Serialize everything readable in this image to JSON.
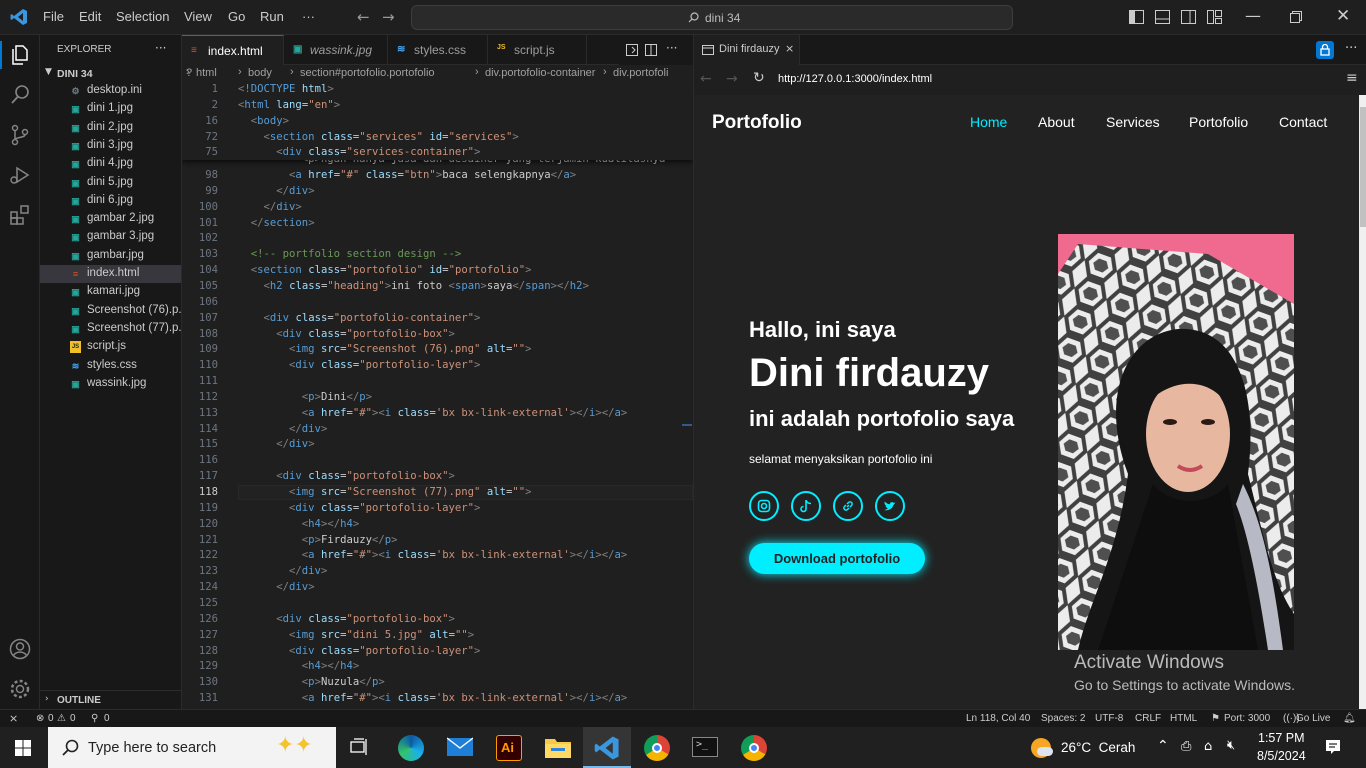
{
  "title_bar": {
    "menus": [
      "File",
      "Edit",
      "Selection",
      "View",
      "Go",
      "Run",
      "···"
    ],
    "command_center": "dini 34"
  },
  "explorer": {
    "title": "EXPLORER",
    "more": "···",
    "folder": "DINI 34",
    "files": [
      {
        "name": "desktop.ini",
        "icon": "gear-icon"
      },
      {
        "name": "dini 1.jpg",
        "icon": "image-icon"
      },
      {
        "name": "dini 2.jpg",
        "icon": "image-icon"
      },
      {
        "name": "dini 3.jpg",
        "icon": "image-icon"
      },
      {
        "name": "dini 4.jpg",
        "icon": "image-icon"
      },
      {
        "name": "dini 5.jpg",
        "icon": "image-icon"
      },
      {
        "name": "dini 6.jpg",
        "icon": "image-icon"
      },
      {
        "name": "gambar 2.jpg",
        "icon": "image-icon"
      },
      {
        "name": "gambar 3.jpg",
        "icon": "image-icon"
      },
      {
        "name": "gambar.jpg",
        "icon": "image-icon"
      },
      {
        "name": "index.html",
        "icon": "html-icon"
      },
      {
        "name": "kamari.jpg",
        "icon": "image-icon"
      },
      {
        "name": "Screenshot (76).p...",
        "icon": "image-icon"
      },
      {
        "name": "Screenshot (77).p...",
        "icon": "image-icon"
      },
      {
        "name": "script.js",
        "icon": "js-icon"
      },
      {
        "name": "styles.css",
        "icon": "css-icon"
      },
      {
        "name": "wassink.jpg",
        "icon": "image-icon"
      }
    ],
    "outline": "OUTLINE"
  },
  "editor": {
    "tabs": [
      {
        "name": "index.html",
        "active": true
      },
      {
        "name": "wassink.jpg",
        "active": false
      },
      {
        "name": "styles.css",
        "active": false
      },
      {
        "name": "script.js",
        "active": false
      }
    ],
    "breadcrumbs": [
      "?",
      "html",
      "body",
      "section#portofolio.portofolio",
      "div.portofolio-container",
      "div.portofoli"
    ],
    "sticky_lines": [
      {
        "n": "1",
        "code": "<!DOCTYPE html>"
      },
      {
        "n": "2",
        "code": "<html lang=\"en\">"
      },
      {
        "n": "16",
        "code": "  <body>"
      },
      {
        "n": "72",
        "code": "    <section class=\"services\" id=\"services\">"
      },
      {
        "n": "75",
        "code": "      <div class=\"services-container\">"
      }
    ],
    "partial_line": "          <p>ngan hanya jasa dan desainer yang terjamin kualitasnya",
    "lines": [
      {
        "n": "98",
        "code": "        <a href=\"#\" class=\"btn\">baca selengkapnya</a>"
      },
      {
        "n": "99",
        "code": "      </div>"
      },
      {
        "n": "100",
        "code": "    </div>"
      },
      {
        "n": "101",
        "code": "  </section>"
      },
      {
        "n": "102",
        "code": ""
      },
      {
        "n": "103",
        "code": "  <!-- portfolio section design -->"
      },
      {
        "n": "104",
        "code": "  <section class=\"portofolio\" id=\"portofolio\">"
      },
      {
        "n": "105",
        "code": "    <h2 class=\"heading\">ini foto <span>saya</span></h2>"
      },
      {
        "n": "106",
        "code": ""
      },
      {
        "n": "107",
        "code": "    <div class=\"portofolio-container\">"
      },
      {
        "n": "108",
        "code": "      <div class=\"portofolio-box\">"
      },
      {
        "n": "109",
        "code": "        <img src=\"Screenshot (76).png\" alt=\"\">"
      },
      {
        "n": "110",
        "code": "        <div class=\"portofolio-layer\">"
      },
      {
        "n": "111",
        "code": ""
      },
      {
        "n": "112",
        "code": "          <p>Dini</p>"
      },
      {
        "n": "113",
        "code": "          <a href=\"#\"><i class='bx bx-link-external'></i></a>"
      },
      {
        "n": "114",
        "code": "        </div>"
      },
      {
        "n": "115",
        "code": "      </div>"
      },
      {
        "n": "116",
        "code": ""
      },
      {
        "n": "117",
        "code": "      <div class=\"portofolio-box\">"
      },
      {
        "n": "118",
        "code": "        <img src=\"Screenshot (77).png\" alt=\"\">"
      },
      {
        "n": "119",
        "code": "        <div class=\"portofolio-layer\">"
      },
      {
        "n": "120",
        "code": "          <h4></h4>"
      },
      {
        "n": "121",
        "code": "          <p>Firdauzy</p>"
      },
      {
        "n": "122",
        "code": "          <a href=\"#\"><i class='bx bx-link-external'></i></a>"
      },
      {
        "n": "123",
        "code": "        </div>"
      },
      {
        "n": "124",
        "code": "      </div>"
      },
      {
        "n": "125",
        "code": ""
      },
      {
        "n": "126",
        "code": "      <div class=\"portofolio-box\">"
      },
      {
        "n": "127",
        "code": "        <img src=\"dini 5.jpg\" alt=\"\">"
      },
      {
        "n": "128",
        "code": "        <div class=\"portofolio-layer\">"
      },
      {
        "n": "129",
        "code": "          <h4></h4>"
      },
      {
        "n": "130",
        "code": "          <p>Nuzula</p>"
      },
      {
        "n": "131",
        "code": "          <a href=\"#\"><i class='bx bx-link-external'></i></a>"
      }
    ],
    "current_line": "118"
  },
  "browser": {
    "tab_title": "Dini firdauzy",
    "url": "http://127.0.0.1:3000/index.html",
    "site": {
      "logo": "Portofolio",
      "nav": [
        "Home",
        "About",
        "Services",
        "Portofolio",
        "Contact"
      ],
      "greeting": "Hallo, ini saya",
      "name": "Dini firdauzy",
      "subtitle": "ini adalah portofolio saya",
      "tagline": "selamat menyaksikan portofolio ini",
      "social": [
        "instagram-icon",
        "tiktok-icon",
        "link-icon",
        "twitter-icon"
      ],
      "button": "Download portofolio",
      "accent": "#00eeff",
      "watermark_title": "Activate Windows",
      "watermark_sub": "Go to Settings to activate Windows."
    }
  },
  "status_bar": {
    "errors": "0",
    "warnings": "0",
    "ports": "0",
    "position": "Ln 118, Col 40",
    "spaces": "Spaces: 2",
    "encoding": "UTF-8",
    "eol": "CRLF",
    "language": "HTML",
    "port": "Port: 3000",
    "golive": "Go Live"
  },
  "taskbar": {
    "search_placeholder": "Type here to search",
    "weather": "26°C  Cerah",
    "time": "1:57 PM",
    "date": "8/5/2024"
  }
}
